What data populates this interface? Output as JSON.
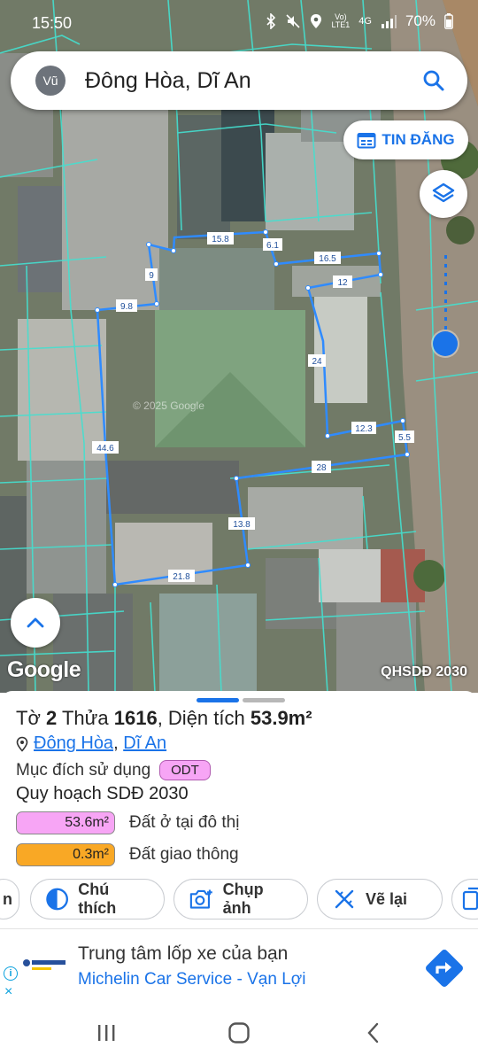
{
  "status_bar": {
    "time": "15:50",
    "net_top": "Vo)",
    "net_bottom": "LTE1",
    "signal_type": "4G",
    "battery": "70%"
  },
  "search": {
    "avatar_letter": "Vũ",
    "query": "Đông Hòa, Dĩ An"
  },
  "map": {
    "tin_dang_label": "TIN ĐĂNG",
    "google_label": "Google",
    "layer_label": "QHSDĐ 2030",
    "watermark": "© 2025 Google",
    "dimensions": [
      "15.8",
      "6.1",
      "9",
      "16.5",
      "12",
      "9.8",
      "24",
      "12.3",
      "5.5",
      "44.6",
      "28",
      "13.8",
      "21.8"
    ]
  },
  "parcel": {
    "to_label": "Tờ",
    "to_value": "2",
    "thua_label": "Thửa",
    "thua_value": "1616",
    "area_label": ", Diện tích",
    "area_value": "53.9m²",
    "ward": "Đông Hòa",
    "district": "Dĩ An",
    "separator": ", ",
    "purpose_label": "Mục đích sử dụng",
    "purpose_code": "ODT",
    "plan_label": "Quy hoạch SDĐ 2030",
    "uses": [
      {
        "area": "53.6m²",
        "label": "Đất ở tại đô thị",
        "color": "#f7a5f5"
      },
      {
        "area": "0.3m²",
        "label": "Đất giao thông",
        "color": "#f9a825"
      }
    ]
  },
  "actions": [
    {
      "label": "n"
    },
    {
      "label": "Chú thích"
    },
    {
      "label": "Chụp ảnh"
    },
    {
      "label": "Vẽ lại"
    }
  ],
  "ad": {
    "title": "Trung tâm lốp xe của bạn",
    "subtitle": "Michelin Car Service - Vạn Lợi",
    "info_glyph": "i",
    "close_glyph": "×"
  },
  "colors": {
    "accent": "#1a73e8",
    "boundary": "#44e0d0",
    "parcel_line": "#2f8bff"
  }
}
